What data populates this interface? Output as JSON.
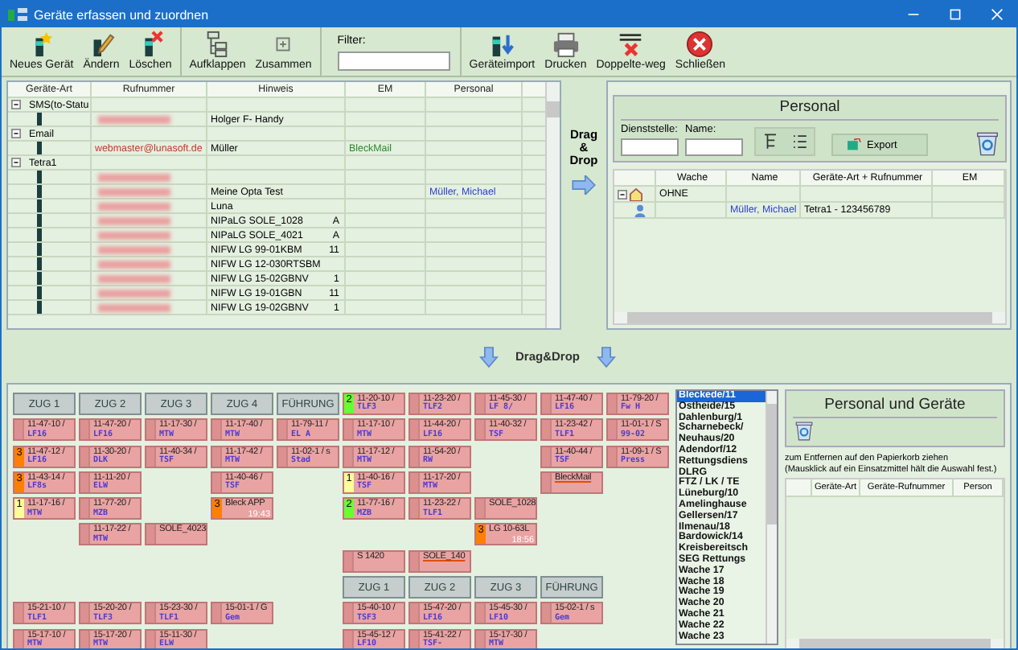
{
  "window": {
    "title": "Geräte erfassen und zuordnen"
  },
  "toolbar": {
    "sections": [
      {
        "kind": "buttons",
        "buttons": [
          {
            "kind": "add",
            "label": "Neues Gerät"
          },
          {
            "kind": "edit",
            "label": "Ändern"
          },
          {
            "kind": "delete",
            "label": "Löschen"
          }
        ]
      },
      {
        "kind": "buttons",
        "buttons": [
          {
            "kind": "expand",
            "label": "Aufklappen"
          },
          {
            "kind": "collapse",
            "label": "Zusammen"
          }
        ]
      },
      {
        "kind": "filter",
        "label": "Filter:"
      },
      {
        "kind": "buttons",
        "buttons": [
          {
            "kind": "import",
            "label": "Geräteimport"
          },
          {
            "kind": "print",
            "label": "Drucken"
          },
          {
            "kind": "dedupe",
            "label": "Doppelte-weg"
          },
          {
            "kind": "close",
            "label": "Schließen"
          }
        ]
      }
    ]
  },
  "device_table": {
    "columns": [
      "Geräte-Art",
      "Rufnummer",
      "Hinweis",
      "EM",
      "Personal"
    ],
    "groups": [
      {
        "name": "SMS(to-Statu",
        "expanded": true,
        "devices": [
          {
            "blurred": true,
            "hinweis": "Holger F- Handy"
          }
        ]
      },
      {
        "name": "Email",
        "expanded": true,
        "devices": [
          {
            "blurred": false,
            "number": "webmaster@lunasoft.de",
            "hinweis": "Müller",
            "em": "BleckMail"
          }
        ]
      },
      {
        "name": "Tetra1",
        "expanded": true,
        "devices": [
          {
            "blurred": true
          },
          {
            "blurred": true,
            "hinweis": "Meine Opta Test",
            "personal": "Müller, Michael"
          },
          {
            "blurred": true,
            "hinweis": "Luna"
          },
          {
            "blurred": true,
            "hinweis": "NIPaLG SOLE_1028",
            "hinweis_tail": "A"
          },
          {
            "blurred": true,
            "hinweis": "NIPaLG SOLE_4021",
            "hinweis_tail": "A"
          },
          {
            "blurred": true,
            "hinweis": "NIFW LG 99-01KBM",
            "hinweis_tail": "11"
          },
          {
            "blurred": true,
            "hinweis": "NIFW LG 12-030RTSBM"
          },
          {
            "blurred": true,
            "hinweis": "NIFW LG 15-02GBNV",
            "hinweis_tail": "1"
          },
          {
            "blurred": true,
            "hinweis": "NIFW LG 19-01GBN",
            "hinweis_tail": "11"
          },
          {
            "blurred": true,
            "hinweis": "NIFW LG 19-02GBNV",
            "hinweis_tail": "1"
          }
        ]
      }
    ]
  },
  "drag_drop": {
    "side_label": "Drag & Drop",
    "center_label": "Drag&Drop"
  },
  "personal": {
    "title": "Personal",
    "dienststelle_label": "Dienststelle:",
    "name_label": "Name:",
    "export_label": "Export",
    "columns": [
      "Wache",
      "Name",
      "Geräte-Art + Rufnummer",
      "EM"
    ],
    "groups": [
      {
        "wache": "OHNE",
        "expanded": true,
        "people": [
          {
            "name": "Müller, Michael",
            "device": "Tetra1 - 123456789"
          }
        ]
      }
    ]
  },
  "board": {
    "rows": [
      [
        {
          "kind": "header",
          "label": "ZUG 1"
        },
        {
          "kind": "header",
          "label": "ZUG 2"
        },
        {
          "kind": "header",
          "label": "ZUG 3"
        },
        {
          "kind": "header",
          "label": "ZUG 4"
        },
        {
          "kind": "header",
          "label": "FÜHRUNG"
        },
        {
          "kind": "unit",
          "line1": "11-20-10 /",
          "line2": "TLF3",
          "count": "2",
          "color": "#66ff33"
        },
        {
          "kind": "unit",
          "line1": "11-23-20 /",
          "line2": "TLF2"
        },
        {
          "kind": "unit",
          "line1": "11-45-30 /",
          "line2": "LF 8/"
        },
        {
          "kind": "unit",
          "line1": "11-47-40 /",
          "line2": "LF16"
        },
        {
          "kind": "unit",
          "line1": "11-79-20 /",
          "line2": "Fw H"
        }
      ],
      [
        {
          "kind": "unit",
          "line1": "11-47-10 /",
          "line2": "LF16"
        },
        {
          "kind": "unit",
          "line1": "11-47-20 /",
          "line2": "LF16"
        },
        {
          "kind": "unit",
          "line1": "11-17-30 /",
          "line2": "MTW"
        },
        {
          "kind": "unit",
          "line1": "11-17-40 /",
          "line2": "MTW"
        },
        {
          "kind": "unit",
          "line1": "11-79-11 /",
          "line2": "EL A"
        },
        {
          "kind": "unit",
          "line1": "11-17-10 /",
          "line2": "MTW"
        },
        {
          "kind": "unit",
          "line1": "11-44-20 /",
          "line2": "LF16"
        },
        {
          "kind": "unit",
          "line1": "11-40-32 /",
          "line2": "TSF"
        },
        {
          "kind": "unit",
          "line1": "11-23-42 /",
          "line2": "TLF1"
        },
        {
          "kind": "unit",
          "line1": "11-01-1 / S",
          "line2": "99-02"
        }
      ],
      [
        {
          "kind": "unit",
          "line1": "11-47-12 /",
          "line2": "LF16",
          "count": "3",
          "color": "#ff8000"
        },
        {
          "kind": "unit",
          "line1": "11-30-20 /",
          "line2": "DLK"
        },
        {
          "kind": "unit",
          "line1": "11-40-34 /",
          "line2": "TSF"
        },
        {
          "kind": "unit",
          "line1": "11-17-42 /",
          "line2": "MTW"
        },
        {
          "kind": "unit",
          "line1": "11-02-1 / s",
          "line2": "Stad"
        },
        {
          "kind": "unit",
          "line1": "11-17-12 /",
          "line2": "MTW"
        },
        {
          "kind": "unit",
          "line1": "11-54-20 /",
          "line2": "RW"
        },
        {
          "kind": "blank"
        },
        {
          "kind": "unit",
          "line1": "11-40-44 /",
          "line2": "TSF"
        },
        {
          "kind": "unit",
          "line1": "11-09-1 / S",
          "line2": "Press"
        }
      ],
      [
        {
          "kind": "unit",
          "line1": "11-43-14 /",
          "line2": "LF8s",
          "count": "3",
          "color": "#ff8000"
        },
        {
          "kind": "unit",
          "line1": "11-11-20 /",
          "line2": "ELW"
        },
        {
          "kind": "blank"
        },
        {
          "kind": "unit",
          "line1": "11-40-46 /",
          "line2": "TSF"
        },
        {
          "kind": "blank"
        },
        {
          "kind": "unit",
          "line1": "11-40-16 /",
          "line2": "TSF",
          "count": "1",
          "color": "#ffff99"
        },
        {
          "kind": "unit",
          "line1": "11-17-20 /",
          "line2": "MTW"
        },
        {
          "kind": "blank"
        },
        {
          "kind": "label",
          "line1": "BleckMail",
          "marked": true
        },
        {
          "kind": "blank"
        }
      ],
      [
        {
          "kind": "unit",
          "line1": "11-17-16 /",
          "line2": "MTW",
          "count": "1",
          "color": "#ffff99"
        },
        {
          "kind": "unit",
          "line1": "11-77-20 /",
          "line2": "MZB"
        },
        {
          "kind": "blank"
        },
        {
          "kind": "label",
          "line1": "Bleck APP",
          "time": "19:43",
          "count": "3",
          "color": "#ff8000",
          "marked": false
        },
        {
          "kind": "blank"
        },
        {
          "kind": "unit",
          "line1": "11-77-16 /",
          "line2": "MZB",
          "count": "2",
          "color": "#66ff33"
        },
        {
          "kind": "unit",
          "line1": "11-23-22 /",
          "line2": "TLF1"
        },
        {
          "kind": "label",
          "line1": "SOLE_1028",
          "marked": false
        },
        {
          "kind": "blank"
        },
        {
          "kind": "blank"
        }
      ],
      [
        {
          "kind": "blank"
        },
        {
          "kind": "unit",
          "line1": "11-17-22 /",
          "line2": "MTW"
        },
        {
          "kind": "label",
          "line1": "SOLE_4023",
          "marked": false
        },
        {
          "kind": "blank"
        },
        {
          "kind": "blank"
        },
        {
          "kind": "blank"
        },
        {
          "kind": "blank"
        },
        {
          "kind": "label",
          "line1": "LG 10-63L",
          "time": "18:56",
          "count": "3",
          "color": "#ff8000",
          "marked": false
        },
        {
          "kind": "blank"
        },
        {
          "kind": "blank"
        }
      ],
      [
        {
          "kind": "blank"
        },
        {
          "kind": "blank"
        },
        {
          "kind": "blank"
        },
        {
          "kind": "blank"
        },
        {
          "kind": "blank"
        },
        {
          "kind": "label",
          "line1": "S 1420",
          "marked": false
        },
        {
          "kind": "label",
          "line1": "SOLE_140",
          "marked": true
        },
        {
          "kind": "blank"
        },
        {
          "kind": "blank"
        },
        {
          "kind": "blank"
        }
      ],
      [
        {
          "kind": "blank"
        },
        {
          "kind": "blank"
        },
        {
          "kind": "blank"
        },
        {
          "kind": "blank"
        },
        {
          "kind": "blank"
        },
        {
          "kind": "header",
          "label": "ZUG 1"
        },
        {
          "kind": "header",
          "label": "ZUG 2"
        },
        {
          "kind": "header",
          "label": "ZUG 3"
        },
        {
          "kind": "header",
          "label": "FÜHRUNG"
        },
        {
          "kind": "blank"
        }
      ],
      [
        {
          "kind": "unit",
          "line1": "15-21-10 /",
          "line2": "TLF1"
        },
        {
          "kind": "unit",
          "line1": "15-20-20 /",
          "line2": "TLF3"
        },
        {
          "kind": "unit",
          "line1": "15-23-30 /",
          "line2": "TLF1"
        },
        {
          "kind": "unit",
          "line1": "15-01-1 / G",
          "line2": "Gem"
        },
        {
          "kind": "blank"
        },
        {
          "kind": "unit",
          "line1": "15-40-10 /",
          "line2": "TSF3"
        },
        {
          "kind": "unit",
          "line1": "15-47-20 /",
          "line2": "LF16"
        },
        {
          "kind": "unit",
          "line1": "15-45-30 /",
          "line2": "LF10"
        },
        {
          "kind": "unit",
          "line1": "15-02-1 / s",
          "line2": "Gem"
        },
        {
          "kind": "blank"
        }
      ],
      [
        {
          "kind": "unit",
          "line1": "15-17-10 /",
          "line2": "MTW"
        },
        {
          "kind": "unit",
          "line1": "15-17-20 /",
          "line2": "MTW"
        },
        {
          "kind": "unit",
          "line1": "15-11-30 /",
          "line2": "ELW"
        },
        {
          "kind": "blank"
        },
        {
          "kind": "blank"
        },
        {
          "kind": "unit",
          "line1": "15-45-12 /",
          "line2": "LF10"
        },
        {
          "kind": "unit",
          "line1": "15-41-22 /",
          "line2": "TSF-"
        },
        {
          "kind": "unit",
          "line1": "15-17-30 /",
          "line2": "MTW"
        },
        {
          "kind": "blank"
        },
        {
          "kind": "blank"
        }
      ]
    ]
  },
  "stations": {
    "items": [
      {
        "label": "Bleckede/11",
        "selected": true
      },
      {
        "label": "Ostheide/15",
        "selected": false
      },
      {
        "label": "Dahlenburg/1",
        "selected": false
      },
      {
        "label": "Scharnebeck/",
        "selected": false
      },
      {
        "label": "Neuhaus/20",
        "selected": false
      },
      {
        "label": "Adendorf/12",
        "selected": false
      },
      {
        "label": "Rettungsdiens",
        "selected": false
      },
      {
        "label": "DLRG",
        "selected": false
      },
      {
        "label": "FTZ / LK / TE",
        "selected": false
      },
      {
        "label": "Lüneburg/10",
        "selected": false
      },
      {
        "label": "Amelinghause",
        "selected": false
      },
      {
        "label": "Gellersen/17",
        "selected": false
      },
      {
        "label": "Ilmenau/18",
        "selected": false
      },
      {
        "label": "Bardowick/14",
        "selected": false
      },
      {
        "label": "Kreisbereitsch",
        "selected": false
      },
      {
        "label": "SEG Rettungs",
        "selected": false
      },
      {
        "label": "Wache 17",
        "selected": false
      },
      {
        "label": "Wache 18",
        "selected": false
      },
      {
        "label": "Wache 19",
        "selected": false
      },
      {
        "label": "Wache 20",
        "selected": false
      },
      {
        "label": "Wache 21",
        "selected": false
      },
      {
        "label": "Wache 22",
        "selected": false
      },
      {
        "label": "Wache 23",
        "selected": false
      }
    ]
  },
  "assignment": {
    "title": "Personal und Geräte",
    "hint_lines": [
      "zum Entfernen auf den Papierkorb ziehen",
      "(Mausklick auf ein Einsatzmittel hält die Auswahl fest.)"
    ],
    "columns": [
      "Geräte-Art",
      "Geräte-Rufnummer",
      "Person"
    ]
  }
}
